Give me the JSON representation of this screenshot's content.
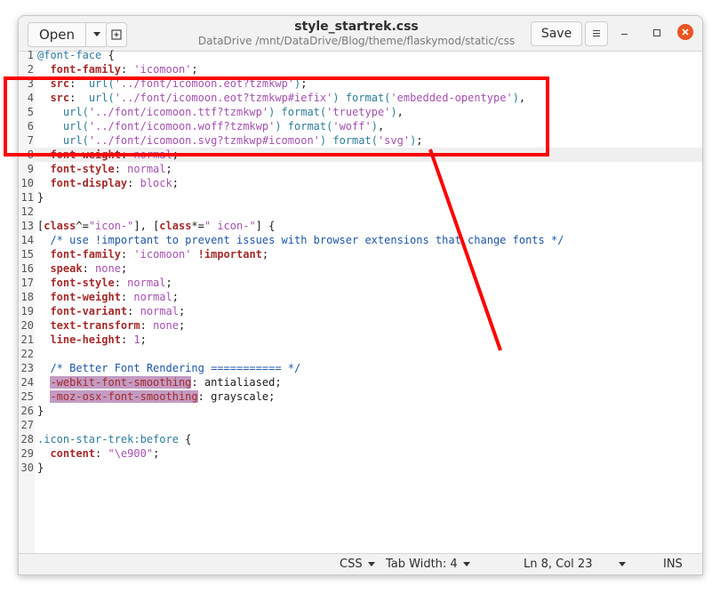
{
  "header": {
    "open_label": "Open",
    "title": "style_startrek.css",
    "subtitle": "DataDrive /mnt/DataDrive/Blog/theme/flaskymod/static/css",
    "save_label": "Save"
  },
  "colors": {
    "keyword": "#a52a2a",
    "string": "#a550b0",
    "selector": "#2e7d9a",
    "comment": "#1c56a8",
    "text": "#1a1a1a",
    "highlight": "#c39bc3",
    "annotation": "#ff0000",
    "close_button": "#e95420"
  },
  "editor": {
    "current_line": 8,
    "lines": [
      {
        "n": "1",
        "t": [
          {
            "c": "selector",
            "s": "@font-face"
          },
          {
            "c": "text",
            "s": " {"
          }
        ]
      },
      {
        "n": "2",
        "t": [
          {
            "c": "text",
            "s": "  "
          },
          {
            "c": "keyword",
            "s": "font-family"
          },
          {
            "c": "text",
            "s": ": "
          },
          {
            "c": "string",
            "s": "'icomoon'"
          },
          {
            "c": "text",
            "s": ";"
          }
        ]
      },
      {
        "n": "3",
        "t": [
          {
            "c": "text",
            "s": "  "
          },
          {
            "c": "keyword",
            "s": "src"
          },
          {
            "c": "text",
            "s": ":  "
          },
          {
            "c": "selector",
            "s": "url("
          },
          {
            "c": "string",
            "s": "'../font/icomoon.eot?tzmkwp'"
          },
          {
            "c": "selector",
            "s": ")"
          },
          {
            "c": "text",
            "s": ";"
          }
        ]
      },
      {
        "n": "4",
        "t": [
          {
            "c": "text",
            "s": "  "
          },
          {
            "c": "keyword",
            "s": "src"
          },
          {
            "c": "text",
            "s": ":  "
          },
          {
            "c": "selector",
            "s": "url("
          },
          {
            "c": "string",
            "s": "'../font/icomoon.eot?tzmkwp#iefix'"
          },
          {
            "c": "selector",
            "s": ") format("
          },
          {
            "c": "string",
            "s": "'embedded-opentype'"
          },
          {
            "c": "selector",
            "s": ")"
          },
          {
            "c": "text",
            "s": ","
          }
        ]
      },
      {
        "n": "5",
        "t": [
          {
            "c": "text",
            "s": "    "
          },
          {
            "c": "selector",
            "s": "url("
          },
          {
            "c": "string",
            "s": "'../font/icomoon.ttf?tzmkwp'"
          },
          {
            "c": "selector",
            "s": ") format("
          },
          {
            "c": "string",
            "s": "'truetype'"
          },
          {
            "c": "selector",
            "s": ")"
          },
          {
            "c": "text",
            "s": ","
          }
        ]
      },
      {
        "n": "6",
        "t": [
          {
            "c": "text",
            "s": "    "
          },
          {
            "c": "selector",
            "s": "url("
          },
          {
            "c": "string",
            "s": "'../font/icomoon.woff?tzmkwp'"
          },
          {
            "c": "selector",
            "s": ") format("
          },
          {
            "c": "string",
            "s": "'woff'"
          },
          {
            "c": "selector",
            "s": ")"
          },
          {
            "c": "text",
            "s": ","
          }
        ]
      },
      {
        "n": "7",
        "t": [
          {
            "c": "text",
            "s": "    "
          },
          {
            "c": "selector",
            "s": "url("
          },
          {
            "c": "string",
            "s": "'../font/icomoon.svg?tzmkwp#icomoon'"
          },
          {
            "c": "selector",
            "s": ") format("
          },
          {
            "c": "string",
            "s": "'svg'"
          },
          {
            "c": "selector",
            "s": ")"
          },
          {
            "c": "text",
            "s": ";"
          }
        ]
      },
      {
        "n": "8",
        "t": [
          {
            "c": "text",
            "s": "  "
          },
          {
            "c": "keyword",
            "s": "font-weight"
          },
          {
            "c": "text",
            "s": ": "
          },
          {
            "c": "string",
            "s": "normal"
          },
          {
            "c": "text",
            "s": ";"
          }
        ]
      },
      {
        "n": "9",
        "t": [
          {
            "c": "text",
            "s": "  "
          },
          {
            "c": "keyword",
            "s": "font-style"
          },
          {
            "c": "text",
            "s": ": "
          },
          {
            "c": "string",
            "s": "normal"
          },
          {
            "c": "text",
            "s": ";"
          }
        ]
      },
      {
        "n": "10",
        "t": [
          {
            "c": "text",
            "s": "  "
          },
          {
            "c": "keyword",
            "s": "font-display"
          },
          {
            "c": "text",
            "s": ": "
          },
          {
            "c": "string",
            "s": "block"
          },
          {
            "c": "text",
            "s": ";"
          }
        ]
      },
      {
        "n": "11",
        "t": [
          {
            "c": "text",
            "s": "}"
          }
        ]
      },
      {
        "n": "12",
        "t": []
      },
      {
        "n": "13",
        "t": [
          {
            "c": "text",
            "s": "["
          },
          {
            "c": "keyword",
            "s": "class"
          },
          {
            "c": "text",
            "s": "^="
          },
          {
            "c": "string",
            "s": "\"icon-\""
          },
          {
            "c": "text",
            "s": "], ["
          },
          {
            "c": "keyword",
            "s": "class"
          },
          {
            "c": "text",
            "s": "*="
          },
          {
            "c": "string",
            "s": "\" icon-\""
          },
          {
            "c": "text",
            "s": "] {"
          }
        ]
      },
      {
        "n": "14",
        "t": [
          {
            "c": "text",
            "s": "  "
          },
          {
            "c": "comment",
            "s": "/* use !important to prevent issues with browser extensions that change fonts */"
          }
        ]
      },
      {
        "n": "15",
        "t": [
          {
            "c": "text",
            "s": "  "
          },
          {
            "c": "keyword",
            "s": "font-family"
          },
          {
            "c": "text",
            "s": ": "
          },
          {
            "c": "string",
            "s": "'icomoon'"
          },
          {
            "c": "text",
            "s": " "
          },
          {
            "c": "keyword",
            "s": "!important"
          },
          {
            "c": "text",
            "s": ";"
          }
        ]
      },
      {
        "n": "16",
        "t": [
          {
            "c": "text",
            "s": "  "
          },
          {
            "c": "keyword",
            "s": "speak"
          },
          {
            "c": "text",
            "s": ": "
          },
          {
            "c": "string",
            "s": "none"
          },
          {
            "c": "text",
            "s": ";"
          }
        ]
      },
      {
        "n": "17",
        "t": [
          {
            "c": "text",
            "s": "  "
          },
          {
            "c": "keyword",
            "s": "font-style"
          },
          {
            "c": "text",
            "s": ": "
          },
          {
            "c": "string",
            "s": "normal"
          },
          {
            "c": "text",
            "s": ";"
          }
        ]
      },
      {
        "n": "18",
        "t": [
          {
            "c": "text",
            "s": "  "
          },
          {
            "c": "keyword",
            "s": "font-weight"
          },
          {
            "c": "text",
            "s": ": "
          },
          {
            "c": "string",
            "s": "normal"
          },
          {
            "c": "text",
            "s": ";"
          }
        ]
      },
      {
        "n": "19",
        "t": [
          {
            "c": "text",
            "s": "  "
          },
          {
            "c": "keyword",
            "s": "font-variant"
          },
          {
            "c": "text",
            "s": ": "
          },
          {
            "c": "string",
            "s": "normal"
          },
          {
            "c": "text",
            "s": ";"
          }
        ]
      },
      {
        "n": "20",
        "t": [
          {
            "c": "text",
            "s": "  "
          },
          {
            "c": "keyword",
            "s": "text-transform"
          },
          {
            "c": "text",
            "s": ": "
          },
          {
            "c": "string",
            "s": "none"
          },
          {
            "c": "text",
            "s": ";"
          }
        ]
      },
      {
        "n": "21",
        "t": [
          {
            "c": "text",
            "s": "  "
          },
          {
            "c": "keyword",
            "s": "line-height"
          },
          {
            "c": "text",
            "s": ": "
          },
          {
            "c": "string",
            "s": "1"
          },
          {
            "c": "text",
            "s": ";"
          }
        ]
      },
      {
        "n": "22",
        "t": []
      },
      {
        "n": "23",
        "t": [
          {
            "c": "text",
            "s": "  "
          },
          {
            "c": "comment",
            "s": "/* Better Font Rendering =========== */"
          }
        ]
      },
      {
        "n": "24",
        "t": [
          {
            "c": "text",
            "s": "  "
          },
          {
            "c": "hl",
            "s": "-webkit-font-smoothing"
          },
          {
            "c": "text",
            "s": ": antialiased;"
          }
        ]
      },
      {
        "n": "25",
        "t": [
          {
            "c": "text",
            "s": "  "
          },
          {
            "c": "hl",
            "s": "-moz-osx-font-smoothing"
          },
          {
            "c": "text",
            "s": ": grayscale;"
          }
        ]
      },
      {
        "n": "26",
        "t": [
          {
            "c": "text",
            "s": "}"
          }
        ]
      },
      {
        "n": "27",
        "t": []
      },
      {
        "n": "28",
        "t": [
          {
            "c": "selector",
            "s": ".icon-star-trek:before"
          },
          {
            "c": "text",
            "s": " {"
          }
        ]
      },
      {
        "n": "29",
        "t": [
          {
            "c": "text",
            "s": "  "
          },
          {
            "c": "keyword",
            "s": "content"
          },
          {
            "c": "text",
            "s": ": "
          },
          {
            "c": "string",
            "s": "\"\\e900\""
          },
          {
            "c": "text",
            "s": ";"
          }
        ]
      },
      {
        "n": "30",
        "t": [
          {
            "c": "text",
            "s": "}"
          }
        ]
      }
    ]
  },
  "statusbar": {
    "language": "CSS",
    "tab_width": "Tab Width: 4",
    "position": "Ln 8, Col 23",
    "mode": "INS"
  }
}
